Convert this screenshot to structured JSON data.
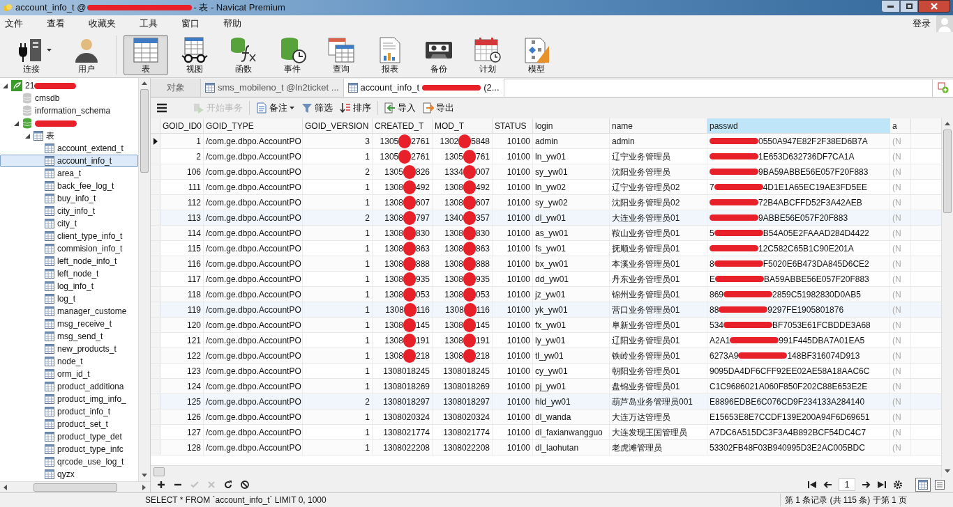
{
  "window": {
    "title": {
      "head": "account_info_t @",
      "tail": "- 表 - Navicat Premium",
      "redacted": true
    }
  },
  "menu": [
    "文件",
    "查看",
    "收藏夹",
    "工具",
    "窗口",
    "帮助"
  ],
  "login": "登录",
  "toolbar": [
    {
      "label": "连接",
      "kind": "connection",
      "selected": false,
      "dropdown": true
    },
    {
      "label": "用户",
      "kind": "user",
      "selected": false,
      "dropdown": false
    },
    {
      "label": "表",
      "kind": "table",
      "selected": true,
      "dropdown": false
    },
    {
      "label": "视图",
      "kind": "view",
      "selected": false,
      "dropdown": false
    },
    {
      "label": "函数",
      "kind": "function",
      "selected": false,
      "dropdown": false
    },
    {
      "label": "事件",
      "kind": "event",
      "selected": false,
      "dropdown": false
    },
    {
      "label": "查询",
      "kind": "query",
      "selected": false,
      "dropdown": false
    },
    {
      "label": "报表",
      "kind": "report",
      "selected": false,
      "dropdown": false
    },
    {
      "label": "备份",
      "kind": "backup",
      "selected": false,
      "dropdown": false
    },
    {
      "label": "计划",
      "kind": "schedule",
      "selected": false,
      "dropdown": false
    },
    {
      "label": "模型",
      "kind": "model",
      "selected": false,
      "dropdown": false
    }
  ],
  "tree": [
    {
      "label": {
        "head": "21",
        "redacted": true
      },
      "kind": "server",
      "expanded": true,
      "selected": false,
      "children": [
        {
          "label": "cmsdb",
          "kind": "database",
          "selected": false
        },
        {
          "label": "information_schema",
          "kind": "database",
          "selected": false
        },
        {
          "label": {
            "redacted": true
          },
          "kind": "database-open",
          "expanded": true,
          "selected": false,
          "children": [
            {
              "label": "表",
              "kind": "folder",
              "expanded": true,
              "selected": false,
              "children": [
                {
                  "label": "account_extend_t",
                  "kind": "table",
                  "selected": false
                },
                {
                  "label": "account_info_t",
                  "kind": "table",
                  "selected": true
                },
                {
                  "label": "area_t",
                  "kind": "table",
                  "selected": false
                },
                {
                  "label": "back_fee_log_t",
                  "kind": "table",
                  "selected": false
                },
                {
                  "label": "buy_info_t",
                  "kind": "table",
                  "selected": false
                },
                {
                  "label": "city_info_t",
                  "kind": "table",
                  "selected": false
                },
                {
                  "label": "city_t",
                  "kind": "table",
                  "selected": false
                },
                {
                  "label": "client_type_info_t",
                  "kind": "table",
                  "selected": false
                },
                {
                  "label": "commision_info_t",
                  "kind": "table",
                  "selected": false
                },
                {
                  "label": "left_node_info_t",
                  "kind": "table",
                  "selected": false
                },
                {
                  "label": "left_node_t",
                  "kind": "table",
                  "selected": false
                },
                {
                  "label": "log_info_t",
                  "kind": "table",
                  "selected": false
                },
                {
                  "label": "log_t",
                  "kind": "table",
                  "selected": false
                },
                {
                  "label": "manager_custome",
                  "kind": "table",
                  "selected": false
                },
                {
                  "label": "msg_receive_t",
                  "kind": "table",
                  "selected": false
                },
                {
                  "label": "msg_send_t",
                  "kind": "table",
                  "selected": false
                },
                {
                  "label": "new_products_t",
                  "kind": "table",
                  "selected": false
                },
                {
                  "label": "node_t",
                  "kind": "table",
                  "selected": false
                },
                {
                  "label": "orm_id_t",
                  "kind": "table",
                  "selected": false
                },
                {
                  "label": "product_additiona",
                  "kind": "table",
                  "selected": false
                },
                {
                  "label": "product_img_info_",
                  "kind": "table",
                  "selected": false
                },
                {
                  "label": "product_info_t",
                  "kind": "table",
                  "selected": false
                },
                {
                  "label": "product_set_t",
                  "kind": "table",
                  "selected": false
                },
                {
                  "label": "product_type_det",
                  "kind": "table",
                  "selected": false
                },
                {
                  "label": "product_type_infc",
                  "kind": "table",
                  "selected": false
                },
                {
                  "label": "qrcode_use_log_t",
                  "kind": "table",
                  "selected": false
                },
                {
                  "label": "qyzx",
                  "kind": "table",
                  "selected": false
                }
              ]
            }
          ]
        }
      ]
    }
  ],
  "tabs": [
    {
      "label": "对象",
      "kind": "objects",
      "selected": false
    },
    {
      "label": "sms_mobileno_t @ln2ticket ...",
      "kind": "table",
      "selected": false
    },
    {
      "label": {
        "head": "account_info_t",
        "tail": "(2...",
        "redacted": true
      },
      "kind": "table",
      "selected": true
    }
  ],
  "object_toolbar": [
    {
      "label": "开始事务",
      "kind": "transaction",
      "disabled": true,
      "dropdown": false
    },
    {
      "label": "备注",
      "kind": "memo",
      "disabled": false,
      "dropdown": true
    },
    {
      "label": "筛选",
      "kind": "filter",
      "disabled": false,
      "dropdown": false
    },
    {
      "label": "排序",
      "kind": "sort",
      "disabled": false,
      "dropdown": false
    },
    {
      "label": "导入",
      "kind": "import",
      "disabled": false,
      "dropdown": false
    },
    {
      "label": "导出",
      "kind": "export",
      "disabled": false,
      "dropdown": false
    }
  ],
  "table": {
    "columns": [
      {
        "label": "GOID_ID0",
        "numeric": true,
        "selected": false
      },
      {
        "label": "GOID_TYPE",
        "numeric": false,
        "selected": false
      },
      {
        "label": "GOID_VERSION",
        "numeric": true,
        "selected": false
      },
      {
        "label": "CREATED_T",
        "numeric": true,
        "selected": false
      },
      {
        "label": "MOD_T",
        "numeric": true,
        "selected": false
      },
      {
        "label": "STATUS",
        "numeric": true,
        "selected": false
      },
      {
        "label": "login",
        "numeric": false,
        "selected": false
      },
      {
        "label": "name",
        "numeric": false,
        "selected": false
      },
      {
        "label": "passwd",
        "numeric": false,
        "selected": true
      },
      {
        "label": "a",
        "numeric": false,
        "selected": false
      }
    ],
    "rows": [
      {
        "current": true,
        "cells": [
          "1",
          "/com.ge.dbpo.AccountPO",
          "3",
          {
            "head": "1305",
            "tail": "2761",
            "redacted": true
          },
          {
            "head": "1302",
            "tail": "5848",
            "redacted": true
          },
          "10100",
          "admin",
          "admin",
          {
            "tail": "0550A947E82F2F38ED6B7A",
            "redacted": true
          },
          "(N"
        ]
      },
      {
        "current": false,
        "cells": [
          "2",
          "/com.ge.dbpo.AccountPO",
          "1",
          {
            "head": "1305",
            "tail": "2761",
            "redacted": true
          },
          {
            "head": "1305",
            "tail": "761",
            "redacted": true
          },
          "10100",
          "ln_yw01",
          "辽宁业务管理员",
          {
            "tail": "1E653D632736DF7CA1A",
            "redacted": true
          },
          "(N"
        ]
      },
      {
        "current": false,
        "cells": [
          "106",
          "/com.ge.dbpo.AccountPO",
          "2",
          {
            "head": "1305",
            "tail": "826",
            "redacted": true
          },
          {
            "head": "1334",
            "tail": "007",
            "redacted": true
          },
          "10100",
          "sy_yw01",
          "沈阳业务管理员",
          {
            "tail": "9BA59ABBE56E057F20F883",
            "redacted": true
          },
          "(N"
        ]
      },
      {
        "current": false,
        "cells": [
          "111",
          "/com.ge.dbpo.AccountPO",
          "1",
          {
            "head": "1308",
            "tail": "492",
            "redacted": true
          },
          {
            "head": "1308",
            "tail": "492",
            "redacted": true
          },
          "10100",
          "ln_yw02",
          "辽宁业务管理员02",
          {
            "head": "7",
            "tail": "4D1E1A65EC19AE3FD5EE",
            "redacted": true
          },
          "(N"
        ]
      },
      {
        "current": false,
        "cells": [
          "112",
          "/com.ge.dbpo.AccountPO",
          "1",
          {
            "head": "1308",
            "tail": "607",
            "redacted": true
          },
          {
            "head": "1308",
            "tail": "607",
            "redacted": true
          },
          "10100",
          "sy_yw02",
          "沈阳业务管理员02",
          {
            "tail": "72B4ABCFFD52F3A42AEB",
            "redacted": true
          },
          "(N"
        ]
      },
      {
        "current": false,
        "cells": [
          "113",
          "/com.ge.dbpo.AccountPO",
          "2",
          {
            "head": "1308",
            "tail": "797",
            "redacted": true
          },
          {
            "head": "1340",
            "tail": "357",
            "redacted": true
          },
          "10100",
          "dl_yw01",
          "大连业务管理员01",
          {
            "tail": "9ABBE56E057F20F883",
            "redacted": true
          },
          "(N"
        ]
      },
      {
        "current": false,
        "cells": [
          "114",
          "/com.ge.dbpo.AccountPO",
          "1",
          {
            "head": "1308",
            "tail": "830",
            "redacted": true
          },
          {
            "head": "1308",
            "tail": "830",
            "redacted": true
          },
          "10100",
          "as_yw01",
          "鞍山业务管理员01",
          {
            "head": "5",
            "tail": "B54A05E2FAAAD284D4422",
            "redacted": true
          },
          "(N"
        ]
      },
      {
        "current": false,
        "cells": [
          "115",
          "/com.ge.dbpo.AccountPO",
          "1",
          {
            "head": "1308",
            "tail": "863",
            "redacted": true
          },
          {
            "head": "1308",
            "tail": "863",
            "redacted": true
          },
          "10100",
          "fs_yw01",
          "抚顺业务管理员01",
          {
            "tail": "12C582C65B1C90E201A",
            "redacted": true
          },
          "(N"
        ]
      },
      {
        "current": false,
        "cells": [
          "116",
          "/com.ge.dbpo.AccountPO",
          "1",
          {
            "head": "1308",
            "tail": "888",
            "redacted": true
          },
          {
            "head": "1308",
            "tail": "888",
            "redacted": true
          },
          "10100",
          "bx_yw01",
          "本溪业务管理员01",
          {
            "head": "8",
            "tail": "F5020E6B473DA845D6CE2",
            "redacted": true
          },
          "(N"
        ]
      },
      {
        "current": false,
        "cells": [
          "117",
          "/com.ge.dbpo.AccountPO",
          "1",
          {
            "head": "1308",
            "tail": "935",
            "redacted": true
          },
          {
            "head": "1308",
            "tail": "935",
            "redacted": true
          },
          "10100",
          "dd_yw01",
          "丹东业务管理员01",
          {
            "head": "E",
            "tail": "BA59ABBE56E057F20F883",
            "redacted": true
          },
          "(N"
        ]
      },
      {
        "current": false,
        "cells": [
          "118",
          "/com.ge.dbpo.AccountPO",
          "1",
          {
            "head": "1308",
            "tail": "053",
            "redacted": true
          },
          {
            "head": "1308",
            "tail": "053",
            "redacted": true
          },
          "10100",
          "jz_yw01",
          "锦州业务管理员01",
          {
            "head": "869",
            "tail": "2859C51982830D0AB5",
            "redacted": true
          },
          "(N"
        ]
      },
      {
        "current": false,
        "cells": [
          "119",
          "/com.ge.dbpo.AccountPO",
          "1",
          {
            "head": "1308",
            "tail": "116",
            "redacted": true
          },
          {
            "head": "1308",
            "tail": "116",
            "redacted": true
          },
          "10100",
          "yk_yw01",
          "营口业务管理员01",
          {
            "head": "88",
            "tail": "9297FE1905801876",
            "redacted": true
          },
          "(N"
        ]
      },
      {
        "current": false,
        "cells": [
          "120",
          "/com.ge.dbpo.AccountPO",
          "1",
          {
            "head": "1308",
            "tail": "145",
            "redacted": true
          },
          {
            "head": "1308",
            "tail": "145",
            "redacted": true
          },
          "10100",
          "fx_yw01",
          "阜新业务管理员01",
          {
            "head": "534",
            "tail": "BF7053E61FCBDDE3A68",
            "redacted": true
          },
          "(N"
        ]
      },
      {
        "current": false,
        "cells": [
          "121",
          "/com.ge.dbpo.AccountPO",
          "1",
          {
            "head": "1308",
            "tail": "191",
            "redacted": true
          },
          {
            "head": "1308",
            "tail": "191",
            "redacted": true
          },
          "10100",
          "ly_yw01",
          "辽阳业务管理员01",
          {
            "head": "A2A1",
            "tail": "991F445DBA7A01EA5",
            "redacted": true
          },
          "(N"
        ]
      },
      {
        "current": false,
        "cells": [
          "122",
          "/com.ge.dbpo.AccountPO",
          "1",
          {
            "head": "1308",
            "tail": "218",
            "redacted": true
          },
          {
            "head": "1308",
            "tail": "218",
            "redacted": true
          },
          "10100",
          "tl_yw01",
          "铁岭业务管理员01",
          {
            "head": "6273A9",
            "tail": "148BF316074D913",
            "redacted": true
          },
          "(N"
        ]
      },
      {
        "current": false,
        "cells": [
          "123",
          "/com.ge.dbpo.AccountPO",
          "1",
          "1308018245",
          "1308018245",
          "10100",
          "cy_yw01",
          "朝阳业务管理员01",
          "9095DA4DF6CFF92EE02AE58A18AAC6C",
          "(N"
        ]
      },
      {
        "current": false,
        "cells": [
          "124",
          "/com.ge.dbpo.AccountPO",
          "1",
          "1308018269",
          "1308018269",
          "10100",
          "pj_yw01",
          "盘锦业务管理员01",
          "C1C9686021A060F850F202C88E653E2E",
          "(N"
        ]
      },
      {
        "current": false,
        "cells": [
          "125",
          "/com.ge.dbpo.AccountPO",
          "2",
          "1308018297",
          "1308018297",
          "10100",
          "hld_yw01",
          "葫芦岛业务管理员001",
          "E8896EDBE6C076CD9F234133A284140",
          "(N"
        ]
      },
      {
        "current": false,
        "cells": [
          "126",
          "/com.ge.dbpo.AccountPO",
          "1",
          "1308020324",
          "1308020324",
          "10100",
          "dl_wanda",
          "大连万达管理员",
          "E15653E8E7CCDF139E200A94F6D69651",
          "(N"
        ]
      },
      {
        "current": false,
        "cells": [
          "127",
          "/com.ge.dbpo.AccountPO",
          "1",
          "1308021774",
          "1308021774",
          "10100",
          "dl_faxianwangguo",
          "大连发现王国管理员",
          "A7DC6A515DC3F3A4B892BCF54DC4C7",
          "(N"
        ]
      },
      {
        "current": false,
        "cells": [
          "128",
          "/com.ge.dbpo.AccountPO",
          "1",
          "1308022208",
          "1308022208",
          "10100",
          "dl_laohutan",
          "老虎滩管理员",
          "53302FB48F03B940995D3E2AC005BDC",
          "(N"
        ]
      }
    ]
  },
  "record_actions": [
    {
      "kind": "add",
      "disabled": false
    },
    {
      "kind": "delete",
      "disabled": false
    },
    {
      "kind": "apply",
      "disabled": true
    },
    {
      "kind": "discard",
      "disabled": true
    },
    {
      "kind": "refresh",
      "disabled": false
    },
    {
      "kind": "stop",
      "disabled": false
    }
  ],
  "pager": {
    "page": "1"
  },
  "view_modes": [
    {
      "kind": "grid",
      "selected": true
    },
    {
      "kind": "form",
      "selected": false
    }
  ],
  "status_bar": {
    "sql": "SELECT * FROM `account_info_t` LIMIT 0, 1000",
    "record": "第 1 条记录 (共 115 条) 于第 1 页"
  }
}
